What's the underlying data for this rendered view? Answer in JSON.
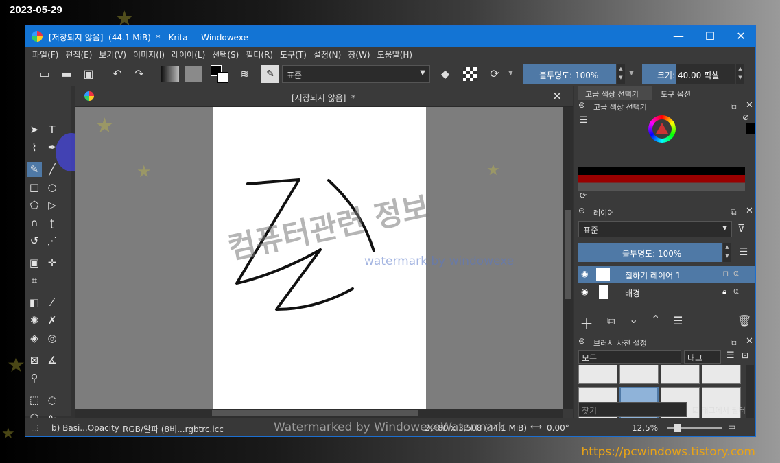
{
  "overlay": {
    "date": "2023-05-29",
    "site": "https://pcwindows.tistory.com",
    "watermark_korean": "컴퓨터관련 정보",
    "watermark_by": "watermark by windowexe",
    "watermark_bottom": "Watermarked by WindowexeWatermark"
  },
  "window": {
    "title": "[저장되지 않음]  (44.1 MiB)  * - Krita   - Windowexe",
    "minimize": "—",
    "maximize": "☐",
    "close": "✕"
  },
  "menu": [
    "파일(F)",
    "편집(E)",
    "보기(V)",
    "이미지(I)",
    "레이어(L)",
    "선택(S)",
    "필터(R)",
    "도구(T)",
    "설정(N)",
    "창(W)",
    "도움말(H)"
  ],
  "toolbar": {
    "blend_mode": "표준",
    "opacity": "불투명도: 100%",
    "size": "크기: 40.00 픽셀"
  },
  "document": {
    "tab_title": "[저장되지 않음]  *",
    "close": "✕"
  },
  "dock": {
    "tabs": [
      "고급 색상 선택기",
      "도구 옵션"
    ],
    "color_panel_title": "고급 색상 선택기",
    "layers_title": "레이어",
    "layer_blend": "표준",
    "layer_opacity": "불투명도:  100%",
    "layers": [
      {
        "name": "칠하기 레이어 1",
        "selected": true
      },
      {
        "name": "배경",
        "selected": false
      }
    ],
    "brush_title": "브러시 사전 설정",
    "brush_filter": "모두",
    "brush_tag": "태그",
    "search_placeholder": "찾기",
    "filter_by_tag": "태그에서 필터"
  },
  "status": {
    "brush": "b) Basi...Opacity",
    "color": "RGB/알파 (8비...rgbtrc.icc",
    "dimensions": "2,480 x 3,508 (44.1 MiB)",
    "rotation": "0.00°",
    "zoom": "12.5%"
  },
  "colors": {
    "titlebar": "#1374d4",
    "accent": "#4f79a6",
    "site": "#e8a317"
  }
}
